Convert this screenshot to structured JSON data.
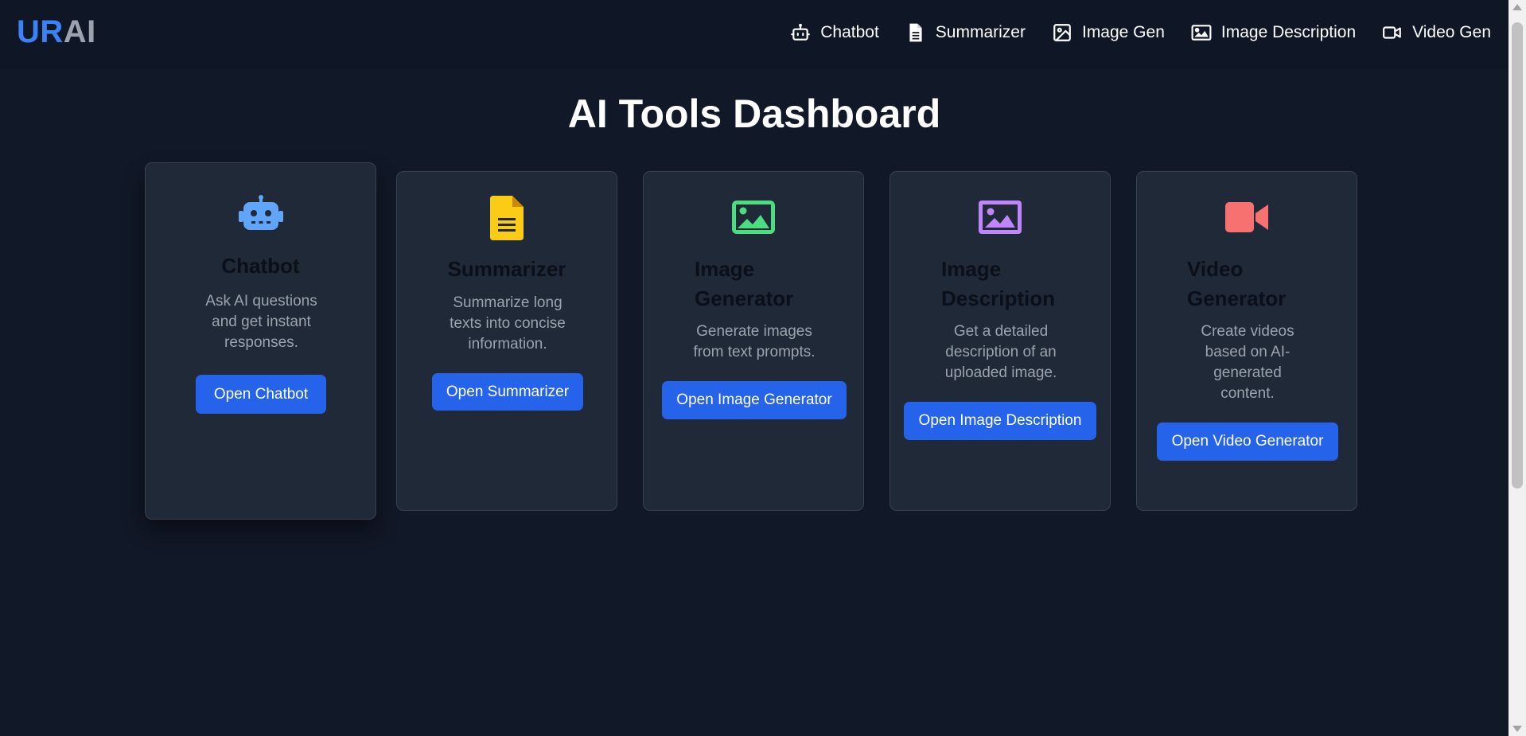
{
  "navbar": {
    "logo": {
      "part1": "UR",
      "part2": "AI"
    },
    "links": [
      {
        "label": "Chatbot",
        "icon": "robot-icon"
      },
      {
        "label": "Summarizer",
        "icon": "file-text-icon"
      },
      {
        "label": "Image Gen",
        "icon": "image-icon"
      },
      {
        "label": "Image Description",
        "icon": "image-landscape-icon"
      },
      {
        "label": "Video Gen",
        "icon": "video-camera-icon"
      }
    ]
  },
  "page": {
    "title": "AI Tools Dashboard"
  },
  "cards": [
    {
      "icon": "robot-icon",
      "icon_color": "#60a5fa",
      "title": "Chatbot",
      "description": "Ask AI questions and get instant responses.",
      "button": "Open Chatbot"
    },
    {
      "icon": "file-text-icon",
      "icon_color": "#facc15",
      "title": "Summarizer",
      "description": "Summarize long texts into concise information.",
      "button": "Open Summarizer"
    },
    {
      "icon": "image-icon",
      "icon_color": "#4ade80",
      "title": "Image Generator",
      "description": "Generate images from text prompts.",
      "button": "Open Image Generator"
    },
    {
      "icon": "image-landscape-icon",
      "icon_color": "#c084fc",
      "title": "Image Description",
      "description": "Get a detailed description of an uploaded image.",
      "button": "Open Image Description"
    },
    {
      "icon": "video-camera-icon",
      "icon_color": "#f87171",
      "title": "Video Generator",
      "description": "Create videos based on AI-generated content.",
      "button": "Open Video Generator"
    }
  ],
  "colors": {
    "background": "#111827",
    "navbar": "#0f1626",
    "card": "#1f2937",
    "button": "#2563eb",
    "logo_accent": "#3b82f6"
  }
}
